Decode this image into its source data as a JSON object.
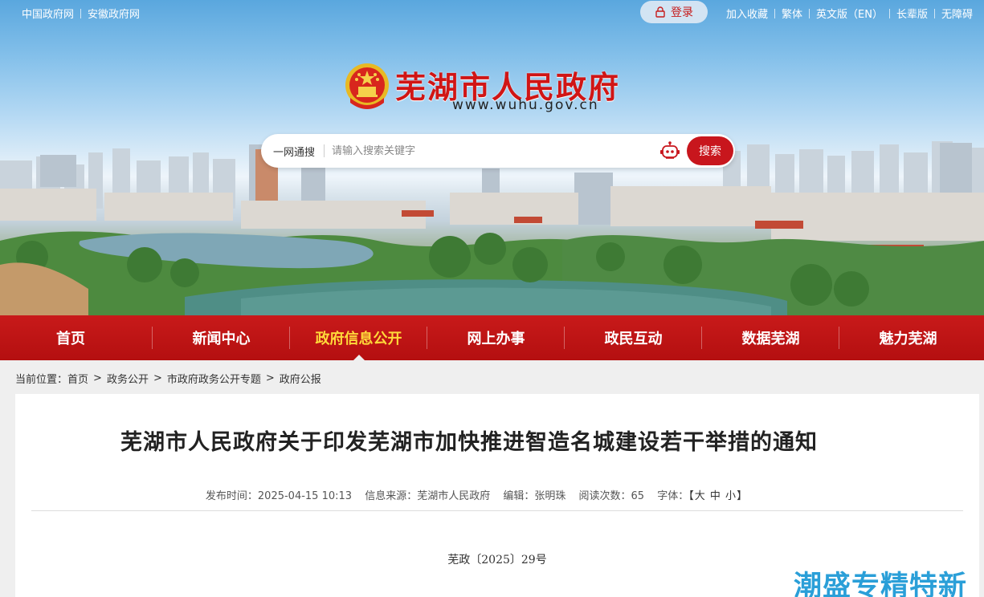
{
  "top_links": {
    "left": [
      "中国政府网",
      "安徽政府网"
    ],
    "login": "登录",
    "right": [
      "加入收藏",
      "繁体",
      "英文版（EN）",
      "长辈版",
      "无障碍"
    ]
  },
  "site": {
    "title": "芜湖市人民政府",
    "url": "www.wuhu.gov.cn"
  },
  "search": {
    "scope": "一网通搜",
    "placeholder": "请输入搜索关键字",
    "button": "搜索"
  },
  "nav": {
    "items": [
      "首页",
      "新闻中心",
      "政府信息公开",
      "网上办事",
      "政民互动",
      "数据芜湖",
      "魅力芜湖"
    ],
    "active_index": 2
  },
  "breadcrumb": {
    "label": "当前位置：",
    "items": [
      "首页",
      "政务公开",
      "市政府政务公开专题",
      "政府公报"
    ],
    "separator": ">"
  },
  "article": {
    "title": "芜湖市人民政府关于印发芜湖市加快推进智造名城建设若干举措的通知",
    "meta": {
      "publish_time": "发布时间：2025-04-15 10:13",
      "source": "信息来源：芜湖市人民政府",
      "editor": "编辑：张明珠",
      "views": "阅读次数：65",
      "font_size_label": "字体：",
      "font_size_open": "【",
      "font_size_options": [
        "大",
        "中",
        "小"
      ],
      "font_size_close": "】"
    },
    "doc_number": "芜政〔2025〕29号"
  },
  "watermark": "潮盛专精特新",
  "colors": {
    "brand_red": "#c8161d",
    "nav_active": "#ffd93a",
    "title_red": "#d01515"
  }
}
